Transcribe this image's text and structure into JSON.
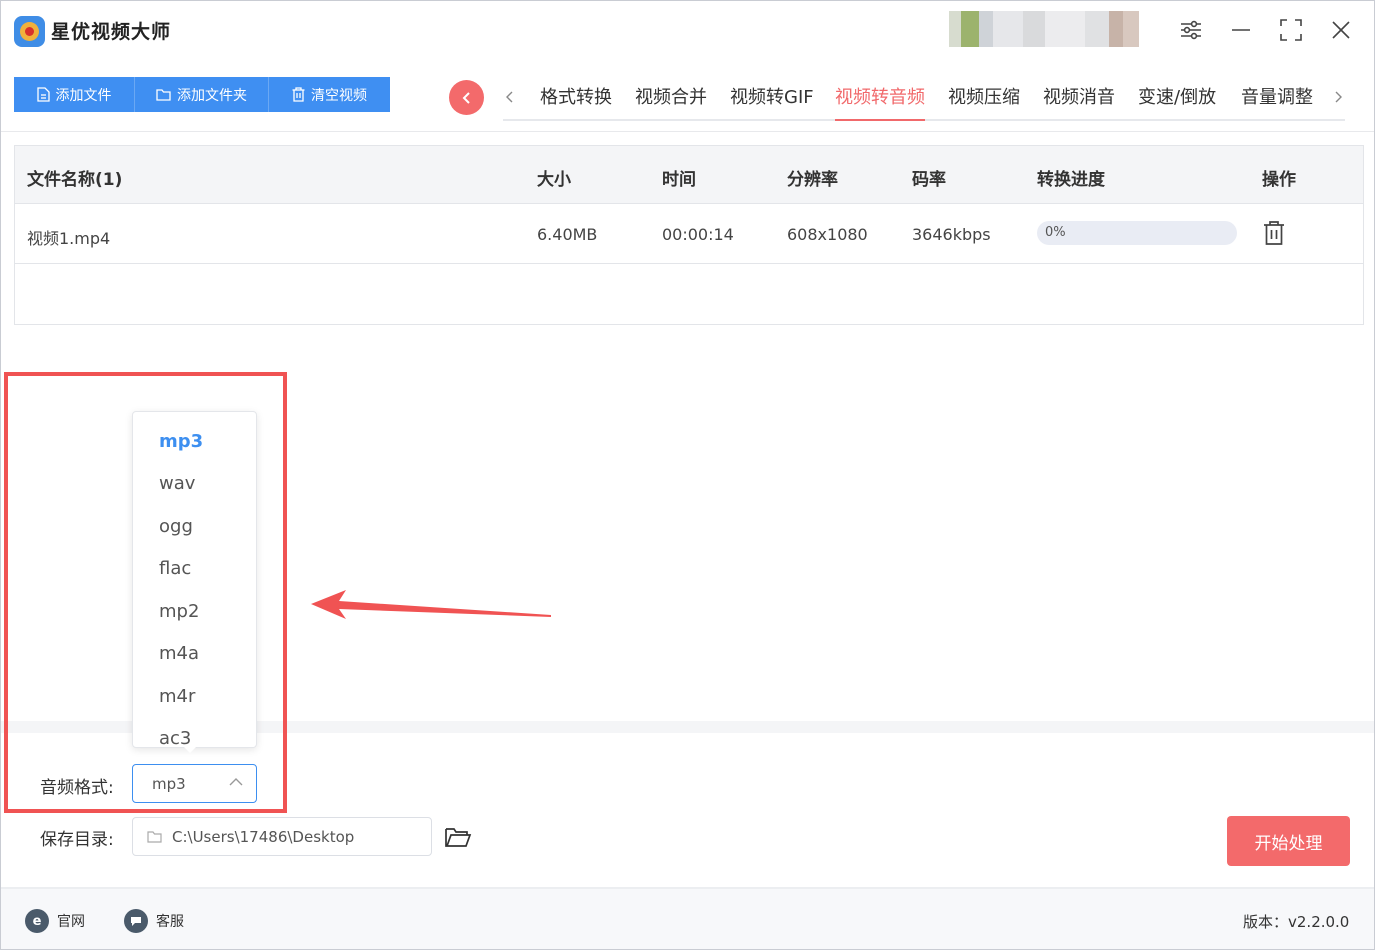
{
  "app": {
    "title": "星优视频大师"
  },
  "toolbar": {
    "add_file": "添加文件",
    "add_folder": "添加文件夹",
    "clear_videos": "清空视频"
  },
  "tabs": [
    {
      "label": "格式转换",
      "active": false
    },
    {
      "label": "视频合并",
      "active": false
    },
    {
      "label": "视频转GIF",
      "active": false
    },
    {
      "label": "视频转音频",
      "active": true
    },
    {
      "label": "视频压缩",
      "active": false
    },
    {
      "label": "视频消音",
      "active": false
    },
    {
      "label": "变速/倒放",
      "active": false
    },
    {
      "label": "音量调整",
      "active": false
    }
  ],
  "table": {
    "headers": {
      "name": "文件名称(1)",
      "size": "大小",
      "time": "时间",
      "resolution": "分辨率",
      "bitrate": "码率",
      "progress": "转换进度",
      "action": "操作"
    },
    "rows": [
      {
        "name": "视频1.mp4",
        "size": "6.40MB",
        "time": "00:00:14",
        "resolution": "608x1080",
        "bitrate": "3646kbps",
        "progress_text": "0%",
        "progress_value": 0
      }
    ]
  },
  "format_dropdown": {
    "options": [
      "mp3",
      "wav",
      "ogg",
      "flac",
      "mp2",
      "m4a",
      "m4r",
      "ac3"
    ],
    "selected": "mp3"
  },
  "settings": {
    "audio_format_label": "音频格式:",
    "audio_format_value": "mp3",
    "save_dir_label": "保存目录:",
    "save_dir_value": "C:\\Users\\17486\\Desktop"
  },
  "actions": {
    "start": "开始处理"
  },
  "footer": {
    "website": "官网",
    "support": "客服",
    "version": "版本：v2.2.0.0"
  },
  "colors": {
    "primary": "#3f8ff2",
    "accent": "#f36a6b",
    "highlight_border": "#f05353"
  }
}
